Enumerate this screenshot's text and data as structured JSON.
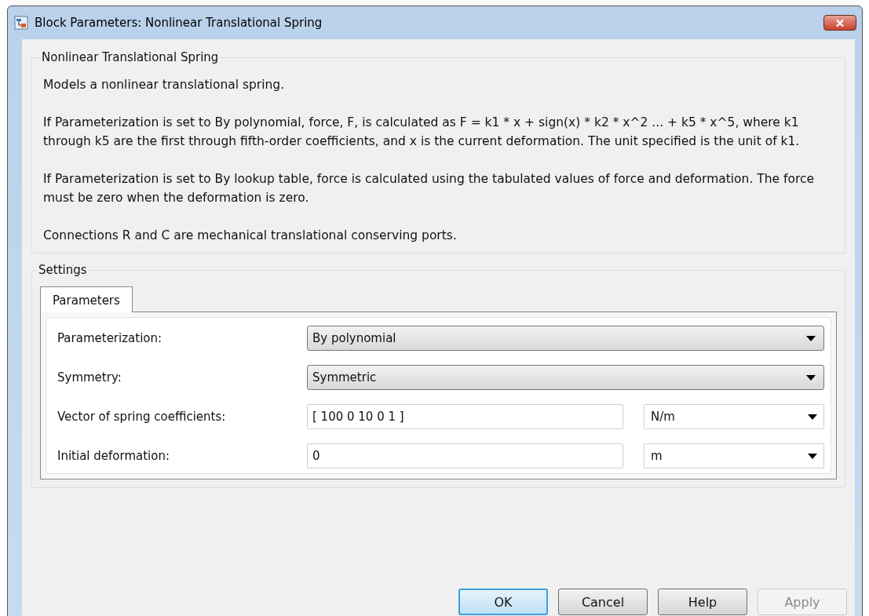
{
  "window": {
    "title": "Block Parameters: Nonlinear Translational Spring"
  },
  "description": {
    "title": "Nonlinear Translational Spring",
    "paragraphs": [
      "Models a nonlinear translational spring.",
      "If Parameterization is set to By polynomial, force, F, is calculated as F = k1 * x + sign(x) * k2 * x^2 ... + k5 * x^5, where k1 through k5 are the first through fifth-order coefficients, and x is the current deformation. The unit specified is the unit of k1.",
      "If Parameterization is set to By lookup table, force is calculated using the tabulated values of force and deformation. The force must be zero when the deformation is zero.",
      "Connections R and C are mechanical translational conserving ports."
    ]
  },
  "settings": {
    "title": "Settings",
    "tabs": [
      {
        "label": "Parameters",
        "selected": true
      }
    ],
    "rows": [
      {
        "kind": "select",
        "label": "Parameterization:",
        "value": "By polynomial"
      },
      {
        "kind": "select",
        "label": "Symmetry:",
        "value": "Symmetric"
      },
      {
        "kind": "text",
        "label": "Vector of spring coefficients:",
        "value": "[ 100 0 10 0 1 ]",
        "unit": "N/m"
      },
      {
        "kind": "text",
        "label": "Initial deformation:",
        "value": "0",
        "unit": "m"
      }
    ]
  },
  "buttons": [
    {
      "label": "OK",
      "default": true,
      "disabled": false
    },
    {
      "label": "Cancel",
      "default": false,
      "disabled": false
    },
    {
      "label": "Help",
      "default": false,
      "disabled": false
    },
    {
      "label": "Apply",
      "default": false,
      "disabled": true
    }
  ]
}
